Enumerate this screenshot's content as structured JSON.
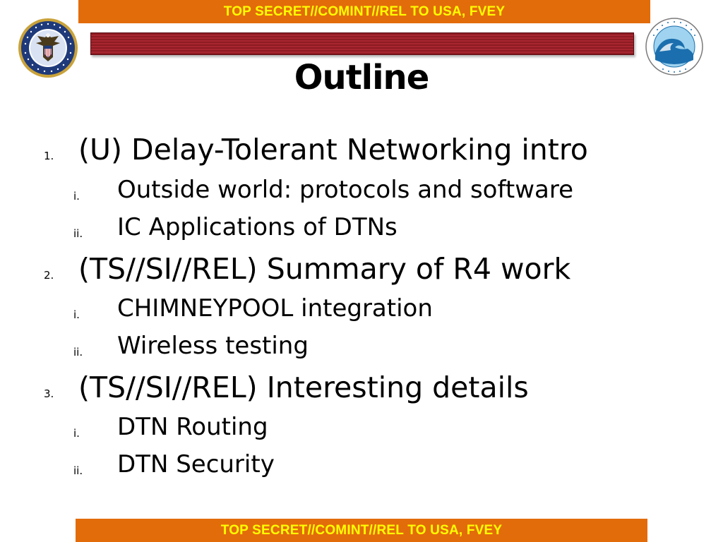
{
  "classification": {
    "top": "TOP SECRET//COMINT//REL TO USA, FVEY",
    "bottom": "TOP SECRET//COMINT//REL TO USA, FVEY"
  },
  "logos": {
    "left_seal": "nsa-seal-icon",
    "right_seal": "directorate-wave-seal-icon",
    "left_seal_text": "NATIONAL SECURITY AGENCY UNITED STATES OF AMERICA",
    "left_seal_colors": [
      "#1f3a7a",
      "#c9a23a",
      "#ffffff"
    ],
    "right_seal_colors": [
      "#1b6fae",
      "#9fd3ef",
      "#ffffff"
    ]
  },
  "colors": {
    "banner_bg": "#e36c0a",
    "banner_text": "#ffff00",
    "header_bar": "#9b1f28"
  },
  "title": "Outline",
  "outline": [
    {
      "number": "1.",
      "text": "(U) Delay-Tolerant Networking intro",
      "subitems": [
        {
          "number": "i.",
          "text": "Outside world: protocols and software"
        },
        {
          "number": "ii.",
          "text": "IC Applications of DTNs"
        }
      ]
    },
    {
      "number": "2.",
      "text": "(TS//SI//REL) Summary of R4 work",
      "subitems": [
        {
          "number": "i.",
          "text": "CHIMNEYPOOL integration"
        },
        {
          "number": "ii.",
          "text": "Wireless testing"
        }
      ]
    },
    {
      "number": "3.",
      "text": "(TS//SI//REL) Interesting details",
      "subitems": [
        {
          "number": "i.",
          "text": "DTN Routing"
        },
        {
          "number": "ii.",
          "text": "DTN Security"
        }
      ]
    }
  ]
}
